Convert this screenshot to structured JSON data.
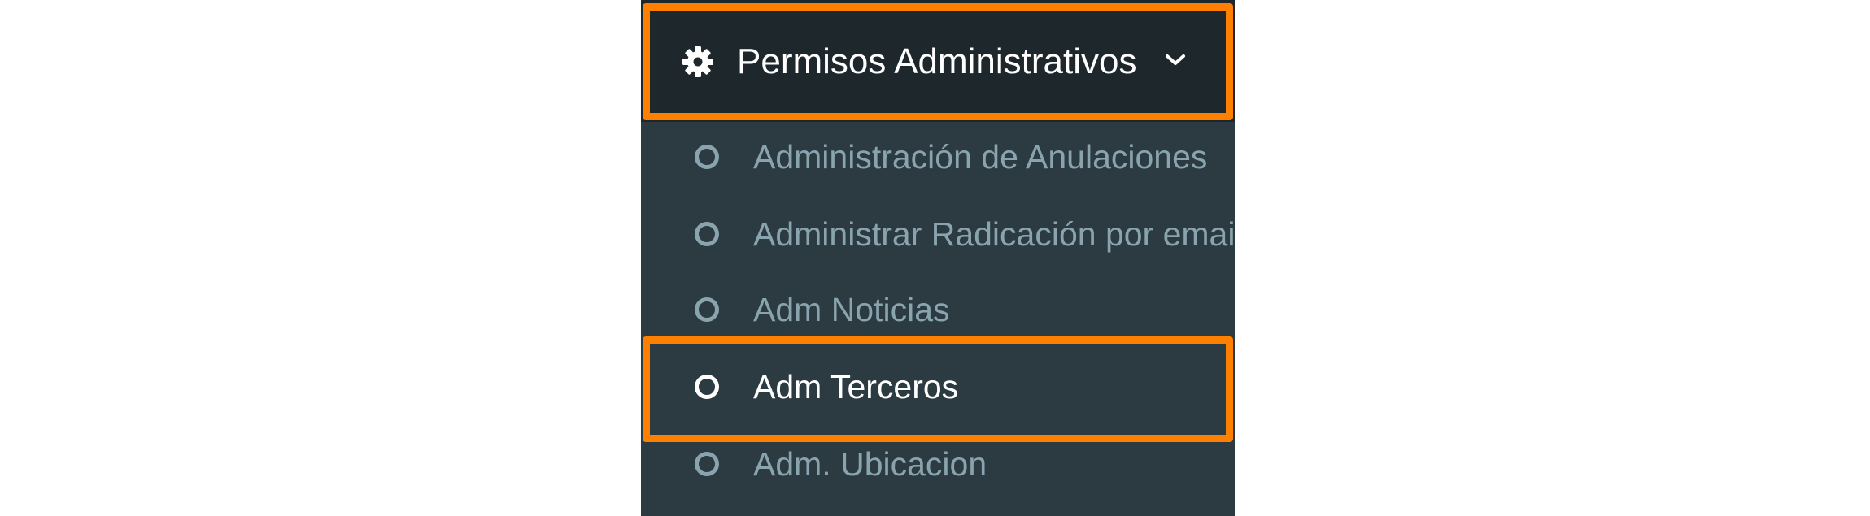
{
  "menu": {
    "header": {
      "label": "Permisos Administrativos",
      "icon": "gear-icon",
      "toggle_icon": "chevron-down-icon",
      "expanded": true
    },
    "items": [
      {
        "label": "Administración de Anulaciones",
        "icon": "circle-icon",
        "active": false
      },
      {
        "label": "Administrar Radicación por email",
        "icon": "circle-icon",
        "active": false
      },
      {
        "label": "Adm Noticias",
        "icon": "circle-icon",
        "active": false
      },
      {
        "label": "Adm Terceros",
        "icon": "circle-icon",
        "active": true
      },
      {
        "label": "Adm. Ubicacion",
        "icon": "circle-icon",
        "active": false
      }
    ]
  },
  "colors": {
    "sidebar_bg": "#2c3b41",
    "header_bg": "#1e282c",
    "highlight": "#ff7f00",
    "inactive_text": "#8aa4af",
    "active_text": "#ffffff"
  }
}
